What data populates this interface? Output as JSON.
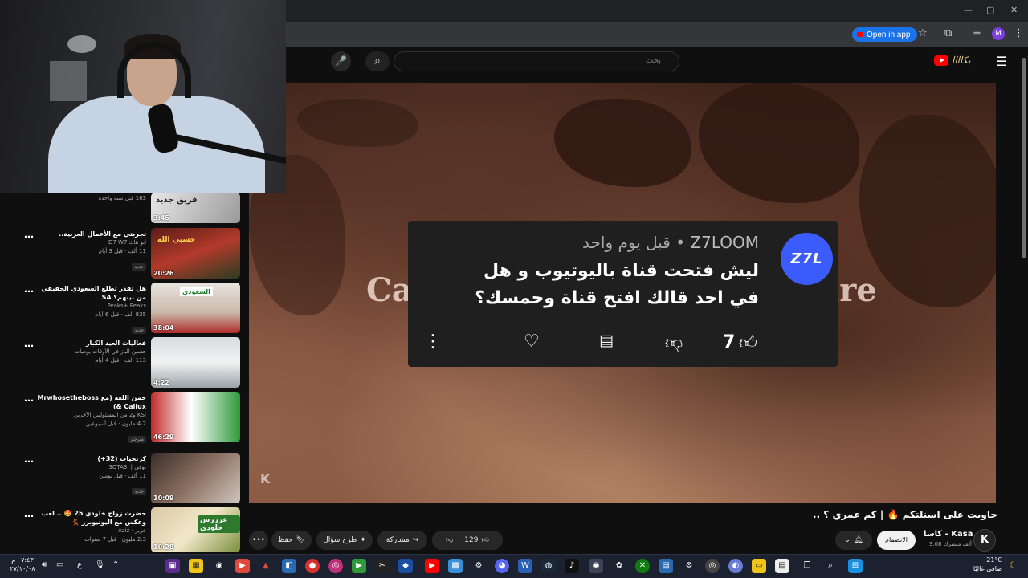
{
  "browser": {
    "open_in_app": "Open in app",
    "profile_initial": "M",
    "icons": [
      "minimize-icon",
      "restore-icon",
      "close-icon",
      "star-icon",
      "extensions-icon",
      "media-icon",
      "kebab-menu-icon"
    ]
  },
  "header": {
    "search_placeholder": "بحث",
    "search_icon": "search-icon",
    "mic_icon": "mic-icon",
    "channel_logo_text": "بكاااا",
    "menu_icon": "hamburger-icon"
  },
  "player": {
    "title_left": "Ca",
    "title_right": "ire",
    "watermark": "K"
  },
  "comment": {
    "avatar_text": "Z7L",
    "author": "Z7LOOM",
    "separator": " • ",
    "time": "قبل يوم واحد",
    "text": "ليش فتحت قناة باليوتيوب و هل في احد قالك افتح قناة وحمسك؟",
    "likes": "7",
    "icons": [
      "more-vert-icon",
      "heart-icon",
      "reply-icon",
      "dislike-icon",
      "like-icon"
    ]
  },
  "video": {
    "title": "جاويت على اسنلتكم 🔥 | كم عمري ؟ ..",
    "channel": "كاسا - Kasa",
    "subscribers": "3.08 ألف مشترك",
    "join": "الانضمام",
    "likes": "129",
    "share": "مشاركة",
    "ask": "طرح سؤال",
    "save": "حفظ"
  },
  "sidebar": {
    "items": [
      {
        "title": "",
        "channel": "",
        "stats": "163 قبل سنة واحدة",
        "badge": "",
        "duration": "3:45",
        "thumb_text": "فريق جديد"
      },
      {
        "title": "تجربتي مع الأعمال العربية..",
        "channel": "أبو هاك D7-W7",
        "stats": "11 ألف · قبل 3 أيام",
        "badge": "جديد",
        "duration": "20:26",
        "thumb_text": "حسبي الله"
      },
      {
        "title": "هل تقدر تطلع السعودي الحقيقي من بينهم؟ SA",
        "channel": "Peaks+ Peaks",
        "stats": "835 ألف · قبل 6 أيام",
        "badge": "جديد",
        "duration": "38:04",
        "thumb_text": "السعودي"
      },
      {
        "title": "فعاليات العيد الكبار",
        "channel": "حسين الباز في الأوقات يوميات",
        "stats": "113 ألف · قبل 4 أيام",
        "badge": "",
        "duration": "4:22",
        "thumb_text": ""
      },
      {
        "title": "خمن اللغة (مع Mrwhosetheboss & Callux)",
        "channel": "KSI و2 من المستوليين الآخرين",
        "stats": "4.2 مليون · قبل أسبوعين",
        "badge": "مُترجم",
        "duration": "46:29",
        "thumb_text": ""
      },
      {
        "title": "كرنجيات (32+)",
        "channel": "نوفي | 3OTA3I",
        "stats": "11 ألف · قبل يومين",
        "badge": "جديد",
        "duration": "10:09",
        "thumb_text": ""
      },
      {
        "title": "حضرت زواج خلودي 25 🤩 .. لعب وعكس مع اليوتيوبرز 💃",
        "channel": "عزيز - Aziz",
        "stats": "2.3 مليون · قبل 7 سنوات",
        "badge": "",
        "duration": "10:28",
        "thumb_text": "عرررس خلودي"
      }
    ]
  },
  "taskbar": {
    "time": "٠٧:٤٣ م",
    "date": "٢٧/١٠/٠٨",
    "lang": "ع",
    "temp": "21°C",
    "weather": "صافي غالبًا"
  },
  "colors": {
    "background": "#0f0f0f",
    "accent_red": "#ff0000",
    "chrome_blue": "#1a73e8",
    "comment_avatar": "#3b5bfd"
  }
}
